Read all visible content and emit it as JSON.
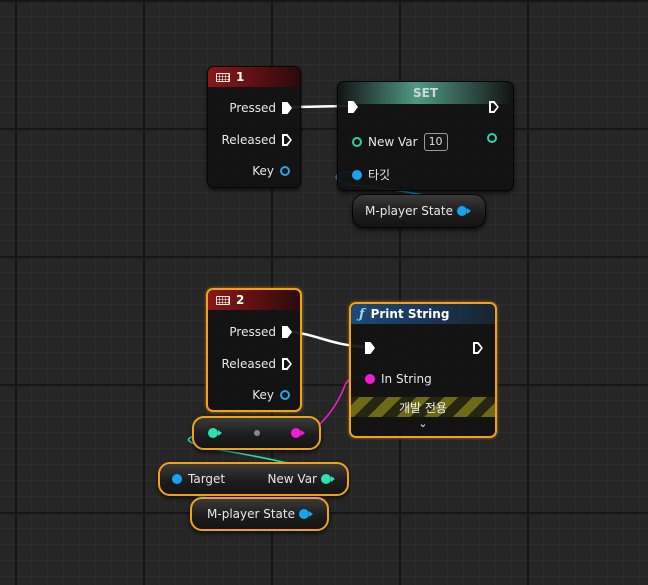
{
  "colors": {
    "grid_bg": "#262626",
    "selection": "#f0a21c",
    "event_header": "#8b1717",
    "set_header": "#4f9a84",
    "func_header": "#1c4a78",
    "exec_wire": "#ffffff",
    "object_pin": "#1aa2ee",
    "int_pin": "#2fe0b0",
    "string_pin": "#f01ed7"
  },
  "event1": {
    "icon": "keyboard-icon",
    "title": "1",
    "pressed": "Pressed",
    "released": "Released",
    "key": "Key"
  },
  "set_node": {
    "title": "SET",
    "new_var": "New Var",
    "new_var_value": "10",
    "target": "타깃"
  },
  "get_state1": {
    "label": "M-player State"
  },
  "event2": {
    "icon": "keyboard-icon",
    "title": "2",
    "pressed": "Pressed",
    "released": "Released",
    "key": "Key"
  },
  "print_string": {
    "icon": "function-icon",
    "title": "Print String",
    "in_string": "In String",
    "dev_only": "개발 전용",
    "expand": "⌄"
  },
  "conversion_node": {
    "type": "reroute-conversion"
  },
  "get_new_var": {
    "target": "Target",
    "new_var": "New Var"
  },
  "get_state2": {
    "label": "M-player State"
  }
}
